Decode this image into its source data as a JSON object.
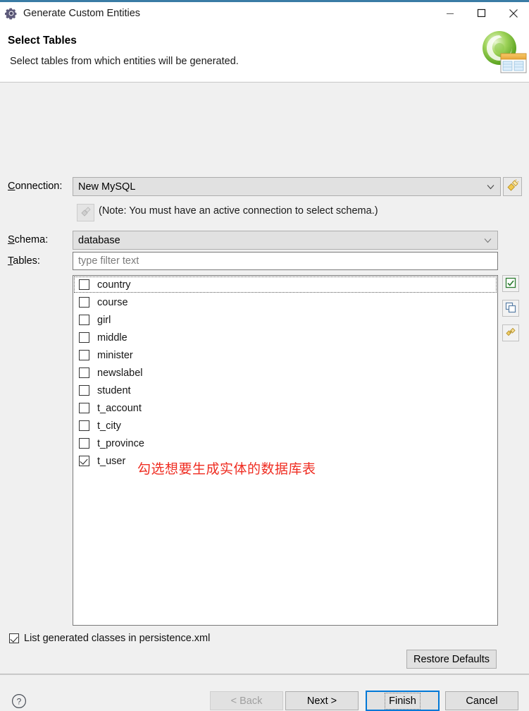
{
  "window": {
    "title": "Generate Custom Entities",
    "icon": "gear-icon",
    "controls": {
      "minimize": "minimize-icon",
      "maximize": "maximize-icon",
      "close": "close-icon"
    }
  },
  "header": {
    "title": "Select Tables",
    "subtitle": "Select tables from which entities will be generated.",
    "banner_icon": "database-table-wizard-icon"
  },
  "form": {
    "connection_label": "Connection:",
    "connection_label_mnemonic": "C",
    "connection_value": "New MySQL",
    "new_connection_icon": "new-connection-wizard-icon",
    "connect_button_icon": "connect-icon",
    "note": "(Note: You must have an active connection to select schema.)",
    "schema_label": "Schema:",
    "schema_label_mnemonic": "S",
    "schema_value": "database",
    "tables_label": "Tables:",
    "tables_label_mnemonic": "T",
    "filter_placeholder": "type filter text"
  },
  "tables": [
    {
      "name": "country",
      "checked": false,
      "focused": true
    },
    {
      "name": "course",
      "checked": false,
      "focused": false
    },
    {
      "name": "girl",
      "checked": false,
      "focused": false
    },
    {
      "name": "middle",
      "checked": false,
      "focused": false
    },
    {
      "name": "minister",
      "checked": false,
      "focused": false
    },
    {
      "name": "newslabel",
      "checked": false,
      "focused": false
    },
    {
      "name": "student",
      "checked": false,
      "focused": false
    },
    {
      "name": "t_account",
      "checked": false,
      "focused": false
    },
    {
      "name": "t_city",
      "checked": false,
      "focused": false
    },
    {
      "name": "t_province",
      "checked": false,
      "focused": false
    },
    {
      "name": "t_user",
      "checked": true,
      "focused": false
    }
  ],
  "side_buttons": [
    {
      "name": "select-all-button",
      "icon": "checked-square-icon"
    },
    {
      "name": "deselect-all-button",
      "icon": "empty-squares-icon"
    },
    {
      "name": "refresh-button",
      "icon": "refresh-links-icon"
    }
  ],
  "annotation": {
    "text": "勾选想要生成实体的数据库表",
    "color": "#ef2d22"
  },
  "options": {
    "persistence_label": "List generated classes in persistence.xml",
    "persistence_checked": true,
    "restore_defaults": "Restore Defaults"
  },
  "footer": {
    "help_icon": "help-icon",
    "back": "< Back",
    "back_mnemonic": "B",
    "back_disabled": true,
    "next": "Next >",
    "next_mnemonic": "N",
    "finish": "Finish",
    "finish_mnemonic": "F",
    "finish_default": true,
    "cancel": "Cancel"
  },
  "colors": {
    "accent": "#3a7ca5",
    "focus_blue": "#0078d7",
    "annotation_red": "#ef2d22",
    "body_bg": "#f0f0f0",
    "titlebar_bg": "#ffffff"
  }
}
